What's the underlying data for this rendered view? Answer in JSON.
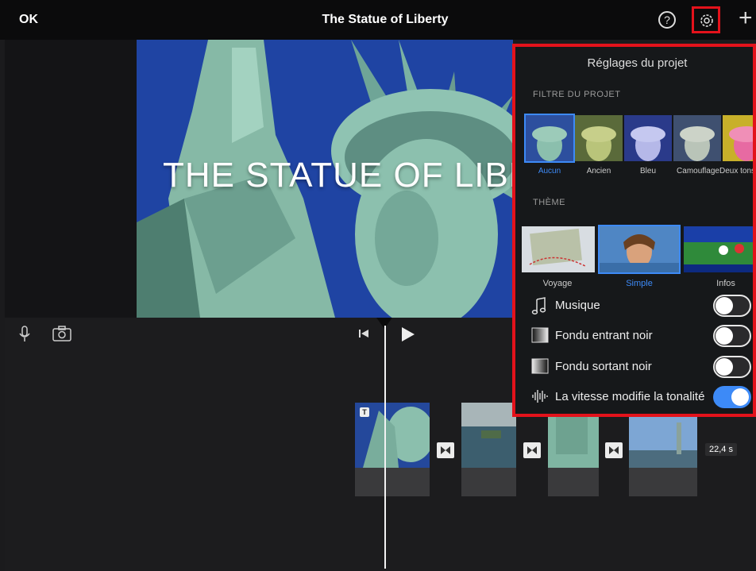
{
  "header": {
    "ok_label": "OK",
    "title": "The Statue of Liberty",
    "help_glyph": "?",
    "plus_glyph": "+"
  },
  "preview": {
    "overlay_title": "THE STATUE OF LIBERTY"
  },
  "timeline": {
    "duration_label": "22,4 s",
    "title_badge": "T"
  },
  "settings_panel": {
    "title": "Réglages du projet",
    "filter_section": "FILTRE DU PROJET",
    "filters": [
      {
        "label": "Aucun",
        "selected": true
      },
      {
        "label": "Ancien",
        "selected": false
      },
      {
        "label": "Bleu",
        "selected": false
      },
      {
        "label": "Camouflage",
        "selected": false
      },
      {
        "label": "Deux tons",
        "selected": false
      }
    ],
    "theme_section": "THÈME",
    "themes": [
      {
        "label": "Voyage",
        "selected": false
      },
      {
        "label": "Simple",
        "selected": true
      },
      {
        "label": "Infos",
        "selected": false
      }
    ],
    "options": [
      {
        "label": "Musique",
        "icon": "music-note-icon",
        "on": false
      },
      {
        "label": "Fondu entrant noir",
        "icon": "fade-in-icon",
        "on": false
      },
      {
        "label": "Fondu sortant noir",
        "icon": "fade-out-icon",
        "on": false
      },
      {
        "label": "La vitesse modifie la tonalité",
        "icon": "waveform-icon",
        "on": true
      }
    ]
  },
  "colors": {
    "accent": "#3d8af7",
    "highlight_border": "#e3121b"
  }
}
